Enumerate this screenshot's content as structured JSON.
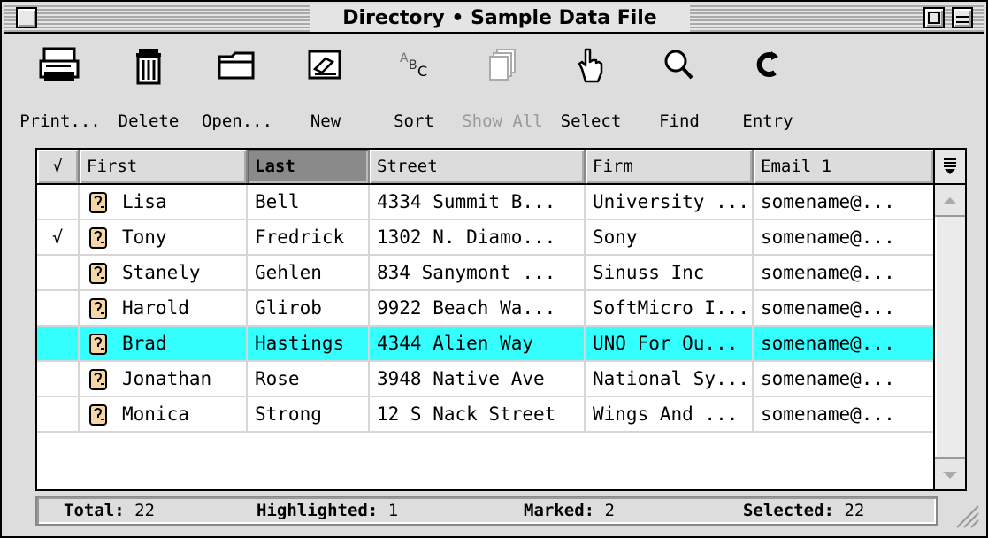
{
  "window": {
    "title": "Directory • Sample Data File"
  },
  "toolbar": {
    "items": [
      {
        "label": "Print...",
        "icon": "printer-icon",
        "enabled": true
      },
      {
        "label": "Delete",
        "icon": "trash-icon",
        "enabled": true
      },
      {
        "label": "Open...",
        "icon": "folder-icon",
        "enabled": true
      },
      {
        "label": "New",
        "icon": "new-card-icon",
        "enabled": true
      },
      {
        "label": "Sort",
        "icon": "sort-abc-icon",
        "enabled": true
      },
      {
        "label": "Show All",
        "icon": "show-all-icon",
        "enabled": false
      },
      {
        "label": "Select",
        "icon": "pointing-hand-icon",
        "enabled": true
      },
      {
        "label": "Find",
        "icon": "magnifier-icon",
        "enabled": true
      },
      {
        "label": "Entry",
        "icon": "entry-c-icon",
        "enabled": true
      }
    ]
  },
  "table": {
    "columns": {
      "mark": "√",
      "first": "First",
      "last": "Last",
      "street": "Street",
      "firm": "Firm",
      "email": "Email 1"
    },
    "sorted_column": "Last",
    "menu_icon": "column-menu-icon",
    "rows": [
      {
        "mark": "",
        "first": "Lisa",
        "last": "Bell",
        "street": "4334 Summit B...",
        "firm": "University ...",
        "email": "somename@...",
        "highlighted": false
      },
      {
        "mark": "√",
        "first": "Tony",
        "last": "Fredrick",
        "street": "1302 N. Diamo...",
        "firm": "Sony",
        "email": "somename@...",
        "highlighted": false
      },
      {
        "mark": "",
        "first": "Stanely",
        "last": "Gehlen",
        "street": "834 Sanymont ...",
        "firm": "Sinuss Inc",
        "email": "somename@...",
        "highlighted": false
      },
      {
        "mark": "",
        "first": "Harold",
        "last": "Glirob",
        "street": "9922 Beach Wa...",
        "firm": "SoftMicro I...",
        "email": "somename@...",
        "highlighted": false
      },
      {
        "mark": "",
        "first": "Brad",
        "last": "Hastings",
        "street": "4344 Alien Way",
        "firm": "UNO For Ou...",
        "email": "somename@...",
        "highlighted": true
      },
      {
        "mark": "",
        "first": "Jonathan",
        "last": "Rose",
        "street": "3948 Native Ave",
        "firm": "National Sy...",
        "email": "somename@...",
        "highlighted": false
      },
      {
        "mark": "",
        "first": "Monica",
        "last": "Strong",
        "street": "12 S Nack Street",
        "firm": "Wings And ...",
        "email": "somename@...",
        "highlighted": false
      }
    ]
  },
  "status": {
    "total_label": "Total:",
    "total_value": "22",
    "highlighted_label": "Highlighted:",
    "highlighted_value": "1",
    "marked_label": "Marked:",
    "marked_value": "2",
    "selected_label": "Selected:",
    "selected_value": "22"
  },
  "colors": {
    "highlight": "#33ffff",
    "sorted_header": "#8a8a8a",
    "chrome": "#dddddd"
  }
}
